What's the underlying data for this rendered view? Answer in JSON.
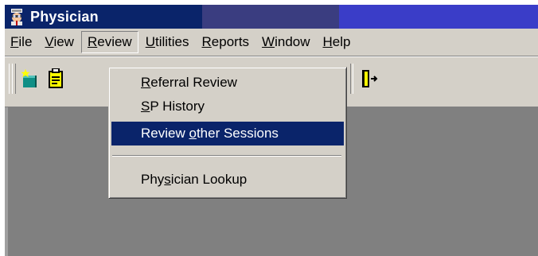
{
  "window": {
    "title": "Physician"
  },
  "menubar": {
    "items": [
      {
        "pre": "",
        "key": "F",
        "post": "ile"
      },
      {
        "pre": "",
        "key": "V",
        "post": "iew"
      },
      {
        "pre": "",
        "key": "R",
        "post": "eview"
      },
      {
        "pre": "",
        "key": "U",
        "post": "tilities"
      },
      {
        "pre": "",
        "key": "R",
        "post": "eports"
      },
      {
        "pre": "",
        "key": "W",
        "post": "indow"
      },
      {
        "pre": "",
        "key": "H",
        "post": "elp"
      }
    ]
  },
  "review_menu": {
    "items": [
      {
        "pre": "",
        "key": "R",
        "post": "eferral Review"
      },
      {
        "pre": "",
        "key": "S",
        "post": "P History"
      },
      {
        "pre": "Review ",
        "key": "o",
        "post": "ther Sessions"
      },
      {
        "pre": "Phy",
        "key": "s",
        "post": "ician Lookup"
      }
    ],
    "highlighted_index": 2
  },
  "toolbar": {
    "icons": [
      "new-record-icon",
      "clipboard-icon",
      "help-icon",
      "exit-door-icon"
    ]
  },
  "colors": {
    "titlebar": "#0a246a",
    "menu_face": "#d4d0c8",
    "highlight": "#0a246a",
    "workspace": "#808080"
  }
}
